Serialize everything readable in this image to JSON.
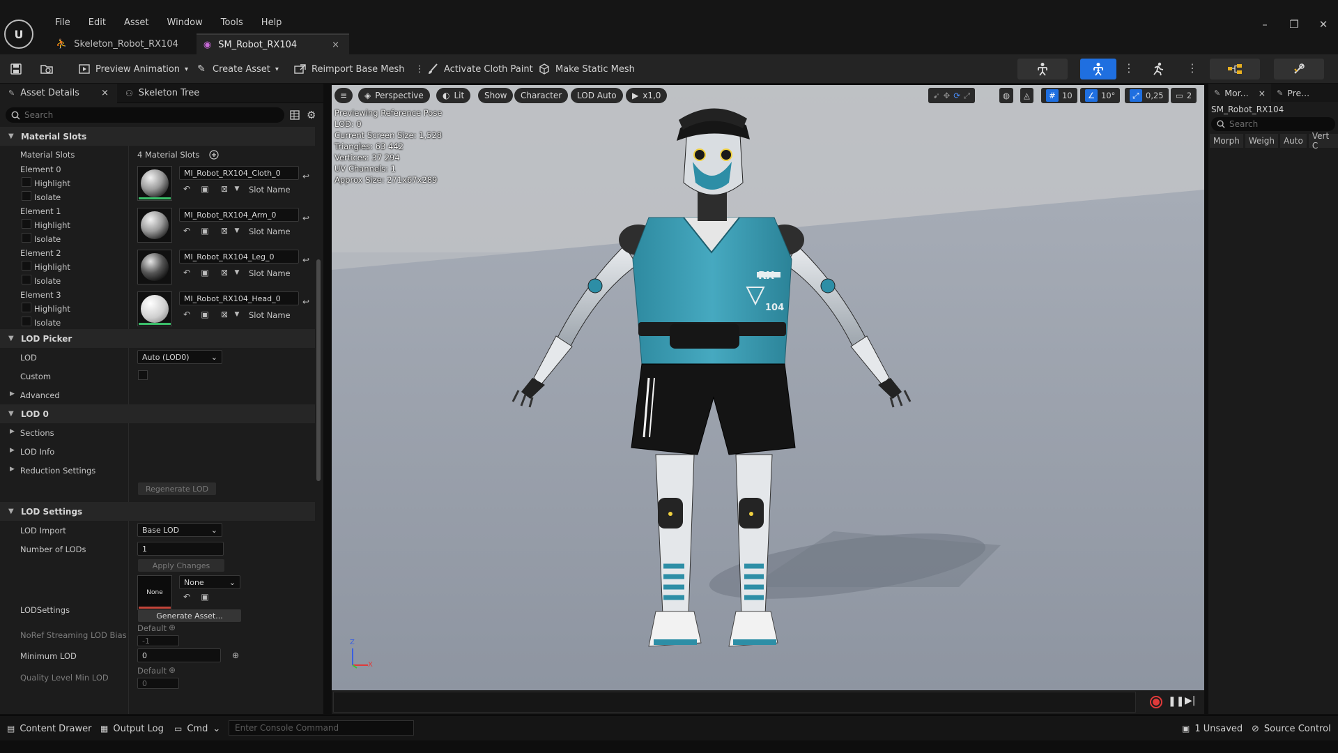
{
  "app": {
    "logo_text": "U"
  },
  "menu": [
    "File",
    "Edit",
    "Asset",
    "Window",
    "Tools",
    "Help"
  ],
  "window_controls": {
    "minimize": "–",
    "restore": "❐",
    "close": "✕"
  },
  "tabs": [
    {
      "label": "Skeleton_Robot_RX104",
      "active": false
    },
    {
      "label": "SM_Robot_RX104",
      "active": true,
      "close": "×"
    }
  ],
  "toolbar": {
    "preview_animation": "Preview Animation",
    "create_asset": "Create Asset",
    "reimport": "Reimport Base Mesh",
    "cloth_paint": "Activate Cloth Paint",
    "make_static": "Make Static Mesh"
  },
  "left_panel": {
    "tab_details": "Asset Details",
    "tab_close": "×",
    "tab_skeleton": "Skeleton Tree",
    "search_placeholder": "Search",
    "material_slots_header": "Material Slots",
    "material_slots_label": "Material Slots",
    "material_slots_count": "4 Material Slots",
    "highlight": "Highlight",
    "isolate": "Isolate",
    "slot_name": "Slot Name",
    "elements": [
      {
        "label": "Element 0",
        "material": "MI_Robot_RX104_Cloth_0"
      },
      {
        "label": "Element 1",
        "material": "MI_Robot_RX104_Arm_0"
      },
      {
        "label": "Element 2",
        "material": "MI_Robot_RX104_Leg_0"
      },
      {
        "label": "Element 3",
        "material": "MI_Robot_RX104_Head_0"
      }
    ],
    "lod_picker_header": "LOD Picker",
    "lod_label": "LOD",
    "lod_value": "Auto (LOD0)",
    "custom_label": "Custom",
    "advanced_label": "Advanced",
    "lod0_header": "LOD 0",
    "sections_label": "Sections",
    "lod_info_label": "LOD Info",
    "reduction_label": "Reduction Settings",
    "regenerate_label": "Regenerate LOD",
    "lod_settings_header": "LOD Settings",
    "lod_import_label": "LOD Import",
    "lod_import_value": "Base LOD",
    "num_lods_label": "Number of LODs",
    "num_lods_value": "1",
    "apply_changes": "Apply Changes",
    "lodsettings_label": "LODSettings",
    "lodsettings_thumb": "None",
    "lodsettings_value": "None",
    "generate_asset": "Generate Asset...",
    "noref_label": "NoRef Streaming LOD Bias",
    "noref_default": "Default",
    "noref_value": "-1",
    "min_lod_label": "Minimum LOD",
    "min_lod_value": "0",
    "quality_label": "Quality Level Min LOD",
    "quality_default": "Default",
    "quality_value": "0"
  },
  "viewport": {
    "perspective": "Perspective",
    "lit": "Lit",
    "show": "Show",
    "character": "Character",
    "lod_auto": "LOD Auto",
    "play_speed": "x1,0",
    "grid_snap": "10",
    "rot_snap": "10°",
    "scale_snap": "0,25",
    "cam_speed": "2",
    "info": [
      "Previewing Reference Pose",
      "LOD: 0",
      "Current Screen Size: 1,528",
      "Triangles: 63 442",
      "Vertices: 37 294",
      "UV Channels: 1",
      "Approx Size: 271x67x289"
    ],
    "shirt_rx": "RX",
    "shirt_num": "104",
    "axis_z": "Z",
    "axis_x": "X"
  },
  "right_panel": {
    "tab_morph": "Mor...",
    "tab_morph_close": "×",
    "tab_preview": "Pre...",
    "asset_name": "SM_Robot_RX104",
    "search_placeholder": "Search",
    "columns": [
      "Morph",
      "Weigh",
      "Auto",
      "Vert C"
    ]
  },
  "status": {
    "content_drawer": "Content Drawer",
    "output_log": "Output Log",
    "cmd": "Cmd",
    "console_placeholder": "Enter Console Command",
    "unsaved": "1 Unsaved",
    "source_control": "Source Control"
  },
  "colors": {
    "accent": "#1f6fe0",
    "shirt": "#3aa0b8",
    "record": "#e03a3a"
  }
}
